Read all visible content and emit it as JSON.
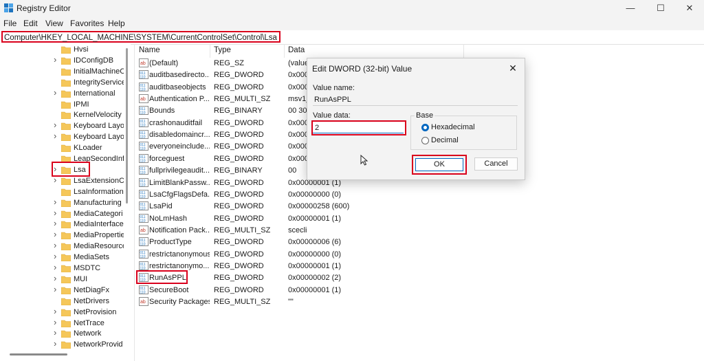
{
  "window": {
    "title": "Registry Editor",
    "minimize": "—",
    "maximize": "☐",
    "close": "✕"
  },
  "menu": [
    "File",
    "Edit",
    "View",
    "Favorites",
    "Help"
  ],
  "address": "Computer\\HKEY_LOCAL_MACHINE\\SYSTEM\\CurrentControlSet\\Control\\Lsa",
  "tree": {
    "items": [
      {
        "label": "Hvsi",
        "expandable": false
      },
      {
        "label": "IDConfigDB",
        "expandable": true
      },
      {
        "label": "InitialMachineC",
        "expandable": false
      },
      {
        "label": "IntegrityService",
        "expandable": false
      },
      {
        "label": "International",
        "expandable": true
      },
      {
        "label": "IPMI",
        "expandable": false
      },
      {
        "label": "KernelVelocity",
        "expandable": false
      },
      {
        "label": "Keyboard Layo",
        "expandable": true
      },
      {
        "label": "Keyboard Layo",
        "expandable": true
      },
      {
        "label": "KLoader",
        "expandable": false
      },
      {
        "label": "LeapSecondInf",
        "expandable": false
      },
      {
        "label": "Lsa",
        "expandable": true
      },
      {
        "label": "LsaExtensionCo",
        "expandable": true
      },
      {
        "label": "LsaInformation",
        "expandable": false
      },
      {
        "label": "Manufacturing",
        "expandable": true
      },
      {
        "label": "MediaCategori",
        "expandable": true
      },
      {
        "label": "MediaInterface",
        "expandable": true
      },
      {
        "label": "MediaPropertie",
        "expandable": true
      },
      {
        "label": "MediaResource",
        "expandable": true
      },
      {
        "label": "MediaSets",
        "expandable": true
      },
      {
        "label": "MSDTC",
        "expandable": true
      },
      {
        "label": "MUI",
        "expandable": true
      },
      {
        "label": "NetDiagFx",
        "expandable": true
      },
      {
        "label": "NetDrivers",
        "expandable": false
      },
      {
        "label": "NetProvision",
        "expandable": true
      },
      {
        "label": "NetTrace",
        "expandable": true
      },
      {
        "label": "Network",
        "expandable": true
      },
      {
        "label": "NetworkProvid",
        "expandable": true
      }
    ]
  },
  "list": {
    "columns": [
      "Name",
      "Type",
      "Data"
    ],
    "rows": [
      {
        "name": "(Default)",
        "type": "REG_SZ",
        "data": "(value",
        "kind": "sz"
      },
      {
        "name": "auditbasedirecto...",
        "type": "REG_DWORD",
        "data": "0x000",
        "kind": "bin"
      },
      {
        "name": "auditbaseobjects",
        "type": "REG_DWORD",
        "data": "0x000",
        "kind": "bin"
      },
      {
        "name": "Authentication P...",
        "type": "REG_MULTI_SZ",
        "data": "msv1_",
        "kind": "sz"
      },
      {
        "name": "Bounds",
        "type": "REG_BINARY",
        "data": "00 30",
        "kind": "bin"
      },
      {
        "name": "crashonauditfail",
        "type": "REG_DWORD",
        "data": "0x000",
        "kind": "bin"
      },
      {
        "name": "disabledomaincr...",
        "type": "REG_DWORD",
        "data": "0x000",
        "kind": "bin"
      },
      {
        "name": "everyoneinclude...",
        "type": "REG_DWORD",
        "data": "0x000",
        "kind": "bin"
      },
      {
        "name": "forceguest",
        "type": "REG_DWORD",
        "data": "0x000",
        "kind": "bin"
      },
      {
        "name": "fullprivilegeaudit...",
        "type": "REG_BINARY",
        "data": "00",
        "kind": "bin"
      },
      {
        "name": "LimitBlankPassw...",
        "type": "REG_DWORD",
        "data": "0x00000001 (1)",
        "kind": "bin"
      },
      {
        "name": "LsaCfgFlagsDefa...",
        "type": "REG_DWORD",
        "data": "0x00000000 (0)",
        "kind": "bin"
      },
      {
        "name": "LsaPid",
        "type": "REG_DWORD",
        "data": "0x00000258 (600)",
        "kind": "bin"
      },
      {
        "name": "NoLmHash",
        "type": "REG_DWORD",
        "data": "0x00000001 (1)",
        "kind": "bin"
      },
      {
        "name": "Notification Pack...",
        "type": "REG_MULTI_SZ",
        "data": "scecli",
        "kind": "sz"
      },
      {
        "name": "ProductType",
        "type": "REG_DWORD",
        "data": "0x00000006 (6)",
        "kind": "bin"
      },
      {
        "name": "restrictanonymous",
        "type": "REG_DWORD",
        "data": "0x00000000 (0)",
        "kind": "bin"
      },
      {
        "name": "restrictanonymo...",
        "type": "REG_DWORD",
        "data": "0x00000001 (1)",
        "kind": "bin"
      },
      {
        "name": "RunAsPPL",
        "type": "REG_DWORD",
        "data": "0x00000002 (2)",
        "kind": "bin"
      },
      {
        "name": "SecureBoot",
        "type": "REG_DWORD",
        "data": "0x00000001 (1)",
        "kind": "bin"
      },
      {
        "name": "Security Packages",
        "type": "REG_MULTI_SZ",
        "data": "\"\"",
        "kind": "sz"
      }
    ]
  },
  "dialog": {
    "title": "Edit DWORD (32-bit) Value",
    "close": "✕",
    "value_name_label": "Value name:",
    "value_name": "RunAsPPL",
    "value_data_label": "Value data:",
    "value_data": "2",
    "base_label": "Base",
    "hex_label": "Hexadecimal",
    "dec_label": "Decimal",
    "ok": "OK",
    "cancel": "Cancel"
  },
  "colors": {
    "highlight": "#d9001b",
    "accent": "#0067c0",
    "folder": "#f5c75a"
  }
}
